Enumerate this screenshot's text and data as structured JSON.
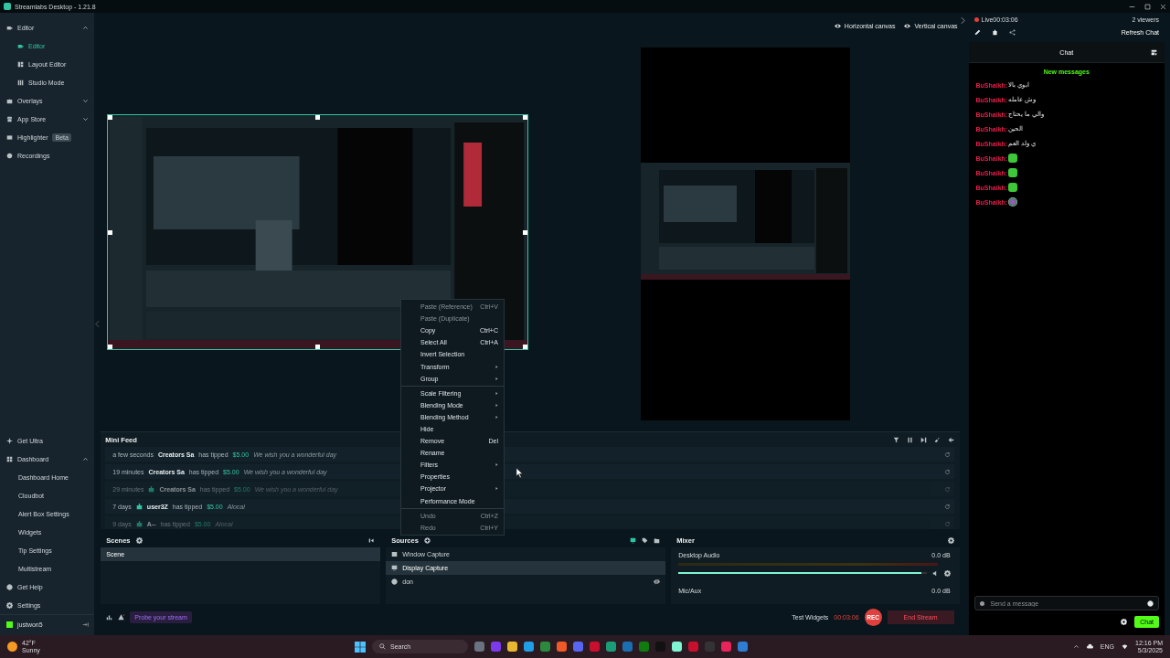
{
  "window": {
    "title": "Streamlabs Desktop - 1.21.8"
  },
  "sidebar": {
    "items": [
      {
        "label": "Editor",
        "expanded": true,
        "children": [
          {
            "label": "Editor",
            "selected": true
          },
          {
            "label": "Layout Editor",
            "selected": false
          },
          {
            "label": "Studio Mode",
            "selected": false
          }
        ]
      },
      {
        "label": "Overlays",
        "expanded": false
      },
      {
        "label": "App Store",
        "expanded": false
      },
      {
        "label": "Highlighter",
        "badge": "Beta"
      },
      {
        "label": "Recordings"
      }
    ],
    "bottom_items": [
      {
        "label": "Get Ultra"
      },
      {
        "label": "Dashboard",
        "expanded": true,
        "children": [
          {
            "label": "Dashboard Home",
            "selected": false
          },
          {
            "label": "Cloudbot",
            "selected": false
          },
          {
            "label": "Alert Box Settings",
            "selected": false
          },
          {
            "label": "Widgets",
            "selected": false
          },
          {
            "label": "Tip Settings",
            "selected": false
          },
          {
            "label": "Multistream",
            "selected": false
          }
        ]
      },
      {
        "label": "Get Help"
      },
      {
        "label": "Settings"
      }
    ],
    "user": {
      "name": "justwon5"
    }
  },
  "canvas_toggles": [
    {
      "label": "Horizontal canvas"
    },
    {
      "label": "Vertical canvas"
    }
  ],
  "mini_feed": {
    "title": "Mini Feed",
    "rows": [
      {
        "time": "a few seconds",
        "platform_icon": false,
        "name": "Creators Sa",
        "action": "has tipped",
        "amount": "$5.00",
        "message": "We wish you a wonderful day",
        "dimmed": false
      },
      {
        "time": "19 minutes",
        "platform_icon": false,
        "name": "Creators Sa",
        "action": "has tipped",
        "amount": "$5.00",
        "message": "We wish you a wonderful day",
        "dimmed": false
      },
      {
        "time": "29 minutes",
        "platform_icon": true,
        "name": "Creators Sa",
        "action": "has tipped",
        "amount": "$5.00",
        "message": "We wish you a wonderful day",
        "dimmed": true
      },
      {
        "time": "7 days",
        "platform_icon": true,
        "name": "user3Z",
        "action": "has tipped",
        "amount": "$5.00",
        "message": "Alocal",
        "dimmed": false
      },
      {
        "time": "9 days",
        "platform_icon": true,
        "name": "A--",
        "action": "has tipped",
        "amount": "$5.00",
        "message": "Alocal",
        "dimmed": true
      }
    ]
  },
  "context_menu": [
    {
      "kind": "item",
      "label": "Paste (Reference)",
      "shortcut": "Ctrl+V",
      "disabled": true
    },
    {
      "kind": "item",
      "label": "Paste (Duplicate)",
      "disabled": true
    },
    {
      "kind": "item",
      "label": "Copy",
      "shortcut": "Ctrl+C",
      "disabled": false
    },
    {
      "kind": "item",
      "label": "Select All",
      "shortcut": "Ctrl+A",
      "disabled": false
    },
    {
      "kind": "item",
      "label": "Invert Selection",
      "disabled": false
    },
    {
      "kind": "submenu",
      "label": "Transform",
      "disabled": false
    },
    {
      "kind": "submenu",
      "label": "Group",
      "disabled": false
    },
    {
      "kind": "separator"
    },
    {
      "kind": "submenu",
      "label": "Scale Filtering",
      "disabled": false
    },
    {
      "kind": "submenu",
      "label": "Blending Mode",
      "disabled": false
    },
    {
      "kind": "submenu",
      "label": "Blending Method",
      "disabled": false
    },
    {
      "kind": "item",
      "label": "Hide",
      "disabled": false
    },
    {
      "kind": "item",
      "label": "Remove",
      "shortcut": "Del",
      "disabled": false
    },
    {
      "kind": "item",
      "label": "Rename",
      "disabled": false
    },
    {
      "kind": "submenu",
      "label": "Filters",
      "disabled": false
    },
    {
      "kind": "item",
      "label": "Properties",
      "disabled": false
    },
    {
      "kind": "submenu",
      "label": "Projector",
      "disabled": false
    },
    {
      "kind": "item",
      "label": "Performance Mode",
      "disabled": false
    },
    {
      "kind": "separator"
    },
    {
      "kind": "item",
      "label": "Undo",
      "shortcut": "Ctrl+Z",
      "disabled": true
    },
    {
      "kind": "item",
      "label": "Redo",
      "shortcut": "Ctrl+Y",
      "disabled": true
    }
  ],
  "scenes": {
    "title": "Scenes",
    "items": [
      {
        "label": "Scene",
        "selected": true
      }
    ]
  },
  "sources": {
    "title": "Sources",
    "items": [
      {
        "label": "Window Capture",
        "kind": "window",
        "selected": false,
        "hidden": false
      },
      {
        "label": "Display Capture",
        "kind": "display",
        "selected": true,
        "hidden": false
      },
      {
        "label": "don",
        "kind": "browser",
        "selected": false,
        "hidden": true
      }
    ]
  },
  "mixer": {
    "title": "Mixer",
    "channels": [
      {
        "name": "Desktop Audio",
        "reading": "0.0 dB",
        "kind": "slider",
        "level": 0.98
      },
      {
        "name": "Mic/Aux",
        "reading": "0.0 dB",
        "kind": "label"
      }
    ]
  },
  "footer": {
    "link": "Probe your stream",
    "test_widgets": "Test Widgets",
    "timer": "00:03:06",
    "rec": "REC",
    "end_stream": "End Stream"
  },
  "chat_panel": {
    "live": "Live00:03:06",
    "viewers": "2 viewers",
    "refresh": "Refresh Chat",
    "title": "Chat",
    "new_messages": "New messages",
    "messages": [
      {
        "user": "BuShaikh:",
        "kind": "text",
        "text": "ابوي بالا"
      },
      {
        "user": "BuShaikh:",
        "kind": "text",
        "text": "وش عامله"
      },
      {
        "user": "BuShaikh:",
        "kind": "text",
        "text": "والي ما يحتاج"
      },
      {
        "user": "BuShaikh:",
        "kind": "text",
        "text": "الحين"
      },
      {
        "user": "BuShaikh:",
        "kind": "text",
        "text": "ي ولد العم"
      },
      {
        "user": "BuShaikh:",
        "kind": "emote"
      },
      {
        "user": "BuShaikh:",
        "kind": "emote"
      },
      {
        "user": "BuShaikh:",
        "kind": "emote"
      },
      {
        "user": "BuShaikh:",
        "kind": "badge"
      }
    ],
    "placeholder": "Send a message",
    "send": "Chat"
  },
  "taskbar": {
    "weather_temp": "42°F",
    "weather_text": "Sunny",
    "search": "Search",
    "language": "ENG",
    "time": "12:16 PM",
    "date": "5/3/2025"
  }
}
